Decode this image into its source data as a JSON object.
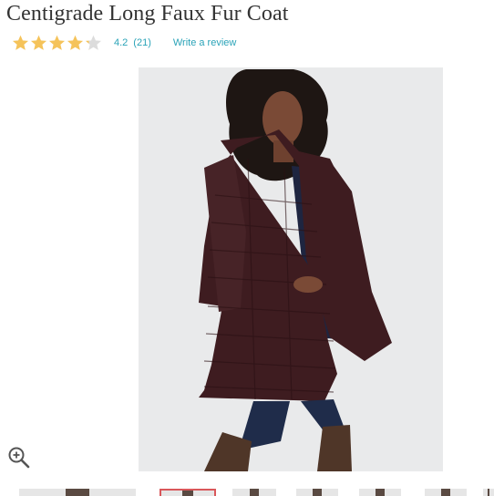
{
  "product": {
    "title": "Centigrade Long Faux Fur Coat"
  },
  "rating": {
    "stars": 4.2,
    "max_stars": 5,
    "value_text": "4.2",
    "count_text": "(21)",
    "write_review_label": "Write a review",
    "star_color": "#f5c35a",
    "star_empty_color": "#dcdcdc",
    "link_color": "#2aa3b8"
  },
  "gallery": {
    "zoom_icon": "zoom-in-icon",
    "thumbnail_count": 8,
    "active_thumbnail": 2
  }
}
